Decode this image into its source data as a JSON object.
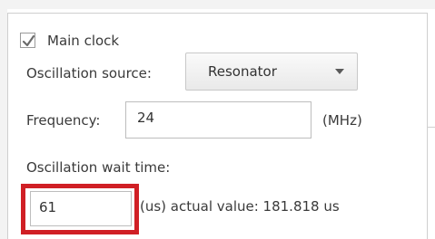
{
  "main_clock": {
    "checkbox_checked": true,
    "label": "Main clock"
  },
  "oscillation_source": {
    "label": "Oscillation source:",
    "selected": "Resonator"
  },
  "frequency": {
    "label": "Frequency:",
    "value": "24",
    "unit": "(MHz)"
  },
  "oscillation_wait_time": {
    "label": "Oscillation wait time:",
    "value": "61",
    "actual_text": "(us) actual value: 181.818 us"
  },
  "colors": {
    "highlight": "#d01f25"
  }
}
